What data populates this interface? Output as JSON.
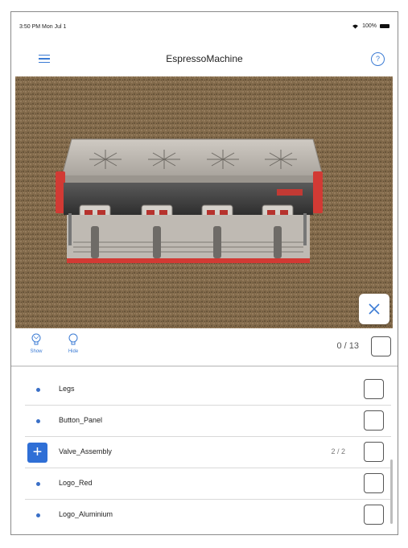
{
  "status_bar": {
    "time": "3:50 PM  Mon Jul 1",
    "battery": "100%"
  },
  "nav": {
    "title": "EspressoMachine"
  },
  "toolbar": {
    "show_label": "Show",
    "hide_label": "Hide",
    "counter": "0 / 13"
  },
  "list": {
    "items": [
      {
        "label": "Legs",
        "type": "part"
      },
      {
        "label": "Button_Panel",
        "type": "part"
      },
      {
        "label": "Valve_Assembly",
        "type": "group",
        "count": "2 / 2"
      },
      {
        "label": "Logo_Red",
        "type": "part"
      },
      {
        "label": "Logo_Aluminium",
        "type": "part"
      }
    ]
  },
  "colors": {
    "accent": "#3b7bd4",
    "group_button": "#2f6fd6",
    "machine_red": "#d23a34"
  }
}
